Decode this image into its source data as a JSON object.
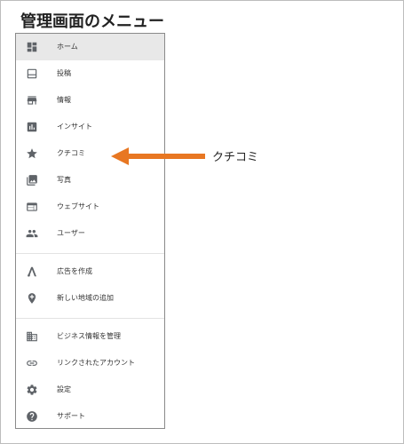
{
  "page": {
    "title": "管理画面のメニュー"
  },
  "menu": {
    "items": [
      {
        "label": "ホーム",
        "icon": "dashboard-icon",
        "active": true
      },
      {
        "label": "投稿",
        "icon": "post-icon"
      },
      {
        "label": "情報",
        "icon": "store-icon"
      },
      {
        "label": "インサイト",
        "icon": "insights-icon"
      },
      {
        "label": "クチコミ",
        "icon": "star-icon"
      },
      {
        "label": "写真",
        "icon": "photo-library-icon"
      },
      {
        "label": "ウェブサイト",
        "icon": "web-icon"
      },
      {
        "label": "ユーザー",
        "icon": "people-icon"
      },
      {
        "label": "広告を作成",
        "icon": "ads-icon"
      },
      {
        "label": "新しい地域の追加",
        "icon": "add-location-icon"
      },
      {
        "label": "ビジネス情報を管理",
        "icon": "business-icon"
      },
      {
        "label": "リンクされたアカウント",
        "icon": "link-icon"
      },
      {
        "label": "設定",
        "icon": "gear-icon"
      },
      {
        "label": "サポート",
        "icon": "help-icon"
      }
    ]
  },
  "callout": {
    "label": "クチコミ",
    "arrow_color": "#E87722"
  },
  "colors": {
    "icon": "#5f6368",
    "active_bg": "#e8e8e8"
  }
}
